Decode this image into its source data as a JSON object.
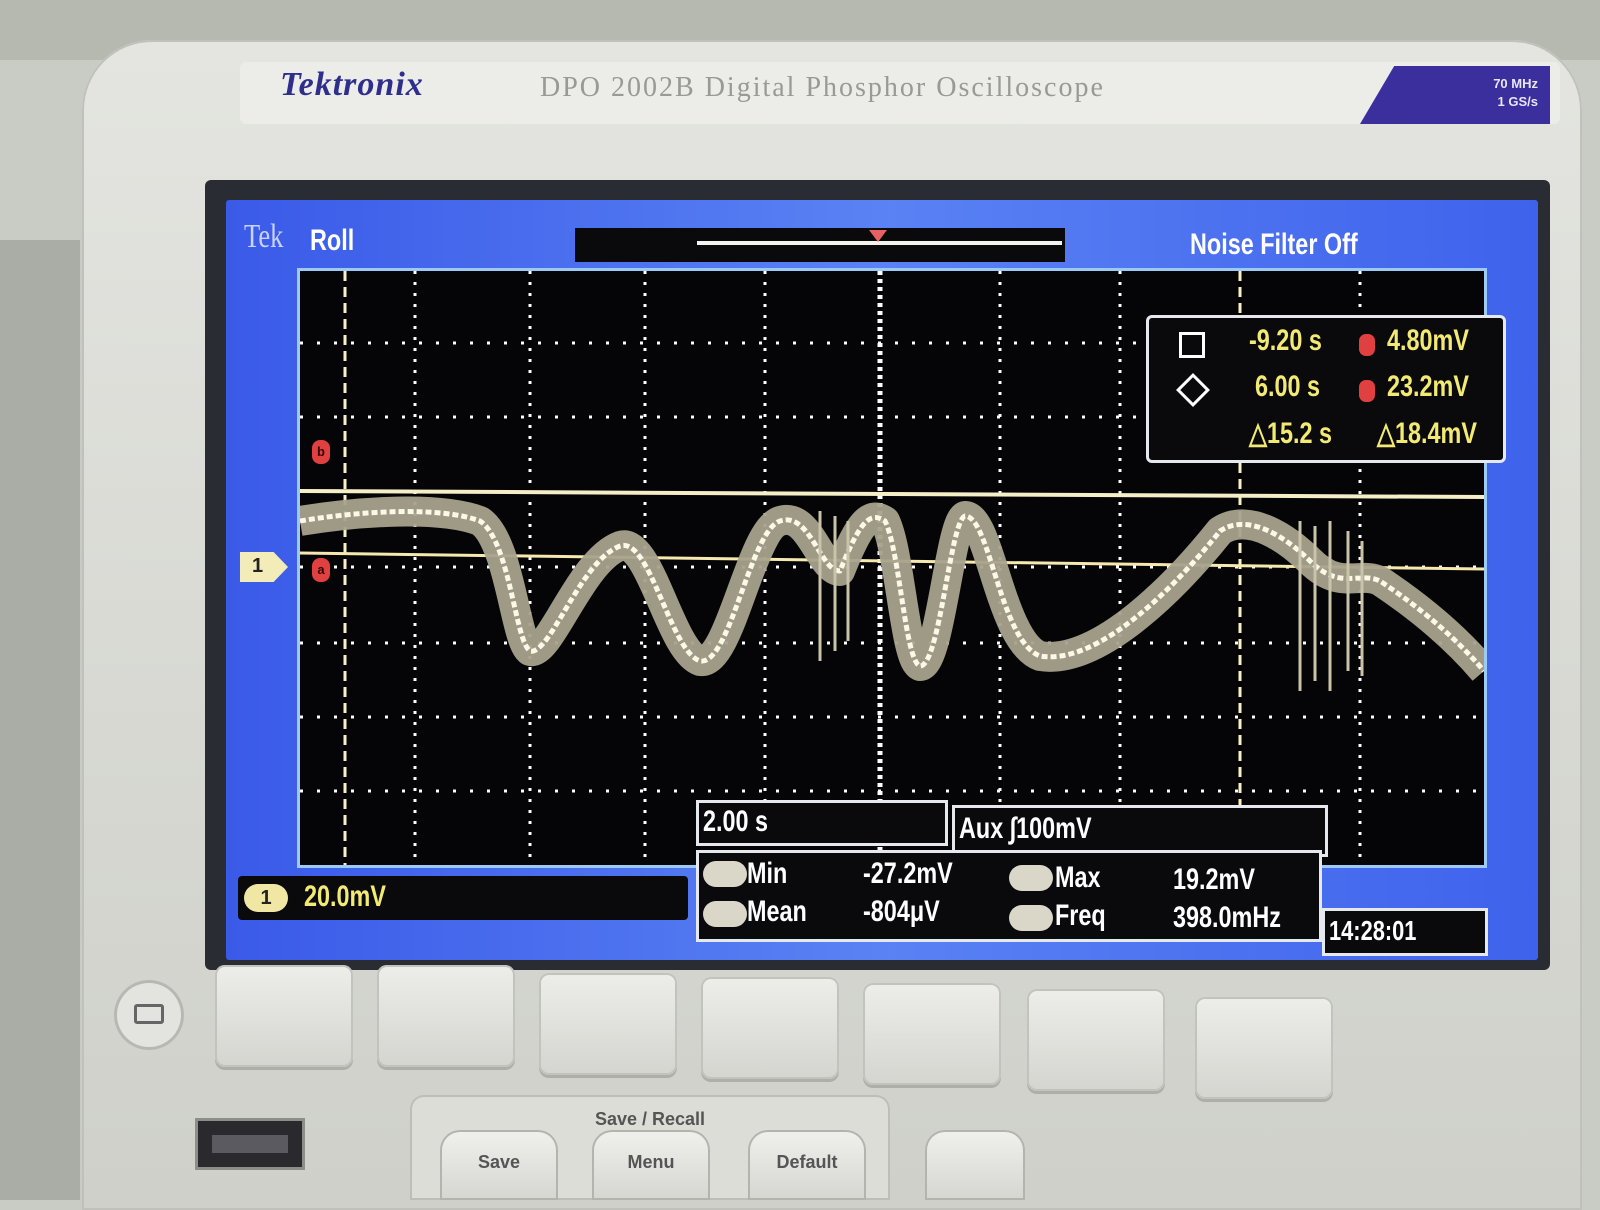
{
  "instrument": {
    "brand": "Tektronix",
    "model": "DPO 2002B Digital Phosphor Oscilloscope",
    "badge_line1": "70 MHz",
    "badge_line2": "1 GS/s"
  },
  "screen": {
    "tek_label": "Tek",
    "mode": "Roll",
    "noise_filter": "Noise Filter Off",
    "channel_marker": "1",
    "cursor_a_marker": "b",
    "cursor_b_marker": "a"
  },
  "cursor_readout": {
    "a_time": "-9.20 s",
    "a_value": "4.80mV",
    "b_time": "6.00 s",
    "b_value": "23.2mV",
    "delta_time": "△15.2 s",
    "delta_value": "△18.4mV"
  },
  "status": {
    "channel_number": "1",
    "channel_scale": "20.0mV",
    "timebase": "2.00 s",
    "trigger": "Aux  ∫100mV",
    "clock": "14:28:01"
  },
  "measurements": [
    {
      "label": "Min",
      "value": "-27.2mV"
    },
    {
      "label": "Max",
      "value": "19.2mV"
    },
    {
      "label": "Mean",
      "value": "-804μV"
    },
    {
      "label": "Freq",
      "value": "398.0mHz"
    }
  ],
  "panel": {
    "save_recall_title": "Save / Recall",
    "save_label": "Save",
    "menu_label": "Menu",
    "default_label": "Default"
  },
  "colors": {
    "screen_blue": "#4a6ef0",
    "trace": "#f3f0dc",
    "readout_yellow": "#f3ea74",
    "cursor_marker_red": "#e04040"
  }
}
